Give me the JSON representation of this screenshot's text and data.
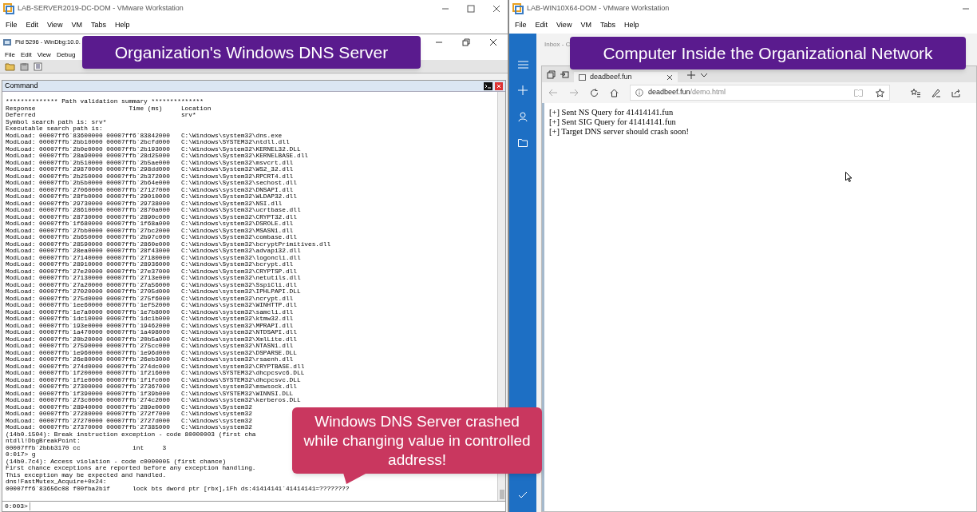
{
  "left_window": {
    "title": "LAB-SERVER2019-DC-DOM - VMware Workstation",
    "menu": [
      "File",
      "Edit",
      "View",
      "VM",
      "Tabs",
      "Help"
    ]
  },
  "windbg": {
    "title": "Pid 5296 - WinDbg:10.0.",
    "menu": [
      "File",
      "Edit",
      "View",
      "Debug"
    ],
    "command_pane": {
      "title": "Command",
      "output": [
        "************** Path validation summary **************",
        "Response                         Time (ms)     Location",
        "Deferred                                       srv*",
        "Symbol search path is: srv*",
        "Executable search path is:",
        "ModLoad: 00007ff6`83600000 00007ff6`83842000   C:\\Windows\\system32\\dns.exe",
        "ModLoad: 00007ffb`2bb10000 00007ffb`2bcfd000   C:\\Windows\\SYSTEM32\\ntdll.dll",
        "ModLoad: 00007ffb`2b0e0000 00007ffb`2b193000   C:\\Windows\\System32\\KERNEL32.DLL",
        "ModLoad: 00007ffb`28a90000 00007ffb`28d25000   C:\\Windows\\System32\\KERNELBASE.dll",
        "ModLoad: 00007ffb`2b510000 00007ffb`2b5ae000   C:\\Windows\\System32\\msvcrt.dll",
        "ModLoad: 00007ffb`29870000 00007ffb`298dd000   C:\\Windows\\System32\\WS2_32.dll",
        "ModLoad: 00007ffb`2b250000 00007ffb`2b372000   C:\\Windows\\System32\\RPCRT4.dll",
        "ModLoad: 00007ffb`2b5b0000 00007ffb`2b64e000   C:\\Windows\\System32\\sechost.dll",
        "ModLoad: 00007ffb`27060000 00007ffb`27127000   C:\\Windows\\system32\\DNSAPI.dll",
        "ModLoad: 00007ffb`28fb0000 00007ffb`29010000   C:\\Windows\\System32\\WLDAP32.dll",
        "ModLoad: 00007ffb`29730000 00007ffb`29738000   C:\\Windows\\System32\\NSI.dll",
        "ModLoad: 00007ffb`28610000 00007ffb`2870a000   C:\\Windows\\System32\\ucrtbase.dll",
        "ModLoad: 00007ffb`28730000 00007ffb`2890c000   C:\\Windows\\System32\\CRYPT32.dll",
        "ModLoad: 00007ffb`1f680000 00007ffb`1f68a000   C:\\Windows\\system32\\DSROLE.dll",
        "ModLoad: 00007ffb`27bb0000 00007ffb`27bc2000   C:\\Windows\\System32\\MSASN1.dll",
        "ModLoad: 00007ffb`2b650000 00007ffb`2b97c000   C:\\Windows\\System32\\combase.dll",
        "ModLoad: 00007ffb`28590000 00007ffb`2860e000   C:\\Windows\\System32\\bcryptPrimitives.dll",
        "ModLoad: 00007ffb`28ea0000 00007ffb`28f43000   C:\\Windows\\System32\\advapi32.dll",
        "ModLoad: 00007ffb`27140000 00007ffb`27180000   C:\\Windows\\system32\\logoncli.dll",
        "ModLoad: 00007ffb`28910000 00007ffb`28936000   C:\\Windows\\System32\\bcrypt.dll",
        "ModLoad: 00007ffb`27e20000 00007ffb`27e37000   C:\\Windows\\System32\\CRYPTSP.dll",
        "ModLoad: 00007ffb`27130000 00007ffb`2713e000   C:\\Windows\\system32\\netutils.dll",
        "ModLoad: 00007ffb`27a20000 00007ffb`27a56000   C:\\Windows\\system32\\SspiCli.dll",
        "ModLoad: 00007ffb`27020000 00007ffb`2705d000   C:\\Windows\\system32\\IPHLPAPI.DLL",
        "ModLoad: 00007ffb`275d0000 00007ffb`275f6000   C:\\Windows\\system32\\ncrypt.dll",
        "ModLoad: 00007ffb`1ee60000 00007ffb`1ef52000   C:\\Windows\\system32\\WINHTTP.dll",
        "ModLoad: 00007ffb`1e7a0000 00007ffb`1e7b8000   C:\\Windows\\system32\\samcli.dll",
        "ModLoad: 00007ffb`1dc10000 00007ffb`1dc1b000   C:\\Windows\\system32\\ktmw32.dll",
        "ModLoad: 00007ffb`193e0000 00007ffb`19462000   C:\\Windows\\system32\\MPRAPI.dll",
        "ModLoad: 00007ffb`1a470000 00007ffb`1a498000   C:\\Windows\\system32\\NTDSAPI.dll",
        "ModLoad: 00007ffb`20b20000 00007ffb`20b5a000   C:\\Windows\\system32\\XmlLite.dll",
        "ModLoad: 00007ffb`27590000 00007ffb`275cc000   C:\\Windows\\system32\\NTASN1.dll",
        "ModLoad: 00007ffb`1e960000 00007ffb`1e96d000   C:\\Windows\\system32\\DSPARSE.DLL",
        "ModLoad: 00007ffb`26e80000 00007ffb`26eb3000   C:\\Windows\\system32\\rsaenh.dll",
        "ModLoad: 00007ffb`274d0000 00007ffb`274dc000   C:\\Windows\\system32\\CRYPTBASE.dll",
        "ModLoad: 00007ffb`1f200000 00007ffb`1f216000   C:\\Windows\\SYSTEM32\\dhcpcsvc6.DLL",
        "ModLoad: 00007ffb`1f1e0000 00007ffb`1f1fc000   C:\\Windows\\SYSTEM32\\dhcpcsvc.DLL",
        "ModLoad: 00007ffb`27300000 00007ffb`27367000   C:\\Windows\\system32\\mswsock.dll",
        "ModLoad: 00007ffb`1f390000 00007ffb`1f39b000   C:\\Windows\\SYSTEM32\\WINNSI.DLL",
        "ModLoad: 00007ffb`273c0000 00007ffb`274c2000   C:\\Windows\\system32\\kerberos.DLL",
        "ModLoad: 00007ffb`28940000 00007ffb`289e0000   C:\\Windows\\System32",
        "ModLoad: 00007ffb`27280000 00007ffb`272f7000   C:\\Windows\\system32",
        "ModLoad: 00007ffb`27270000 00007ffb`2727d000   C:\\Windows\\system32",
        "ModLoad: 00007ffb`27370000 00007ffb`27385000   C:\\Windows\\system32",
        "(14b0.1504): Break instruction exception - code 80000003 (first cha",
        "ntdll!DbgBreakPoint:",
        "00007ffb`2bbb3170 cc              int     3",
        "0:017> g",
        "(14b0.7c4): Access violation - code c0000005 (first chance)",
        "First chance exceptions are reported before any exception handling.",
        "This exception may be expected and handled.",
        "dns!FastMutex_Acquire+0x24:",
        "00007ff6`83656c08 f00fba2b1f      lock bts dword ptr [rbx],1Fh ds:41414141`41414141=????????"
      ],
      "prompt": "0:003>"
    }
  },
  "right_window": {
    "title": "LAB-WIN10X64-DOM - VMware Workstation",
    "menu": [
      "File",
      "Edit",
      "View",
      "VM",
      "Tabs",
      "Help"
    ]
  },
  "mail_app": {
    "title": "Inbox - C"
  },
  "browser": {
    "tab": {
      "title": "deadbeef.fun"
    },
    "url_host": "deadbeef.fun",
    "url_path": "/demo.html",
    "page_lines": [
      "[+] Sent NS Query for 41414141.fun",
      "[+] Sent SIG Query for 41414141.fun",
      "[+] Target DNS server should crash soon!"
    ]
  },
  "callouts": [
    {
      "kind": "banner",
      "text": "Organization's Windows DNS Server"
    },
    {
      "kind": "banner",
      "text": "Computer Inside the Organizational Network"
    },
    {
      "kind": "bubble",
      "text": "Windows DNS Server crashed while changing value in controlled address!"
    }
  ]
}
